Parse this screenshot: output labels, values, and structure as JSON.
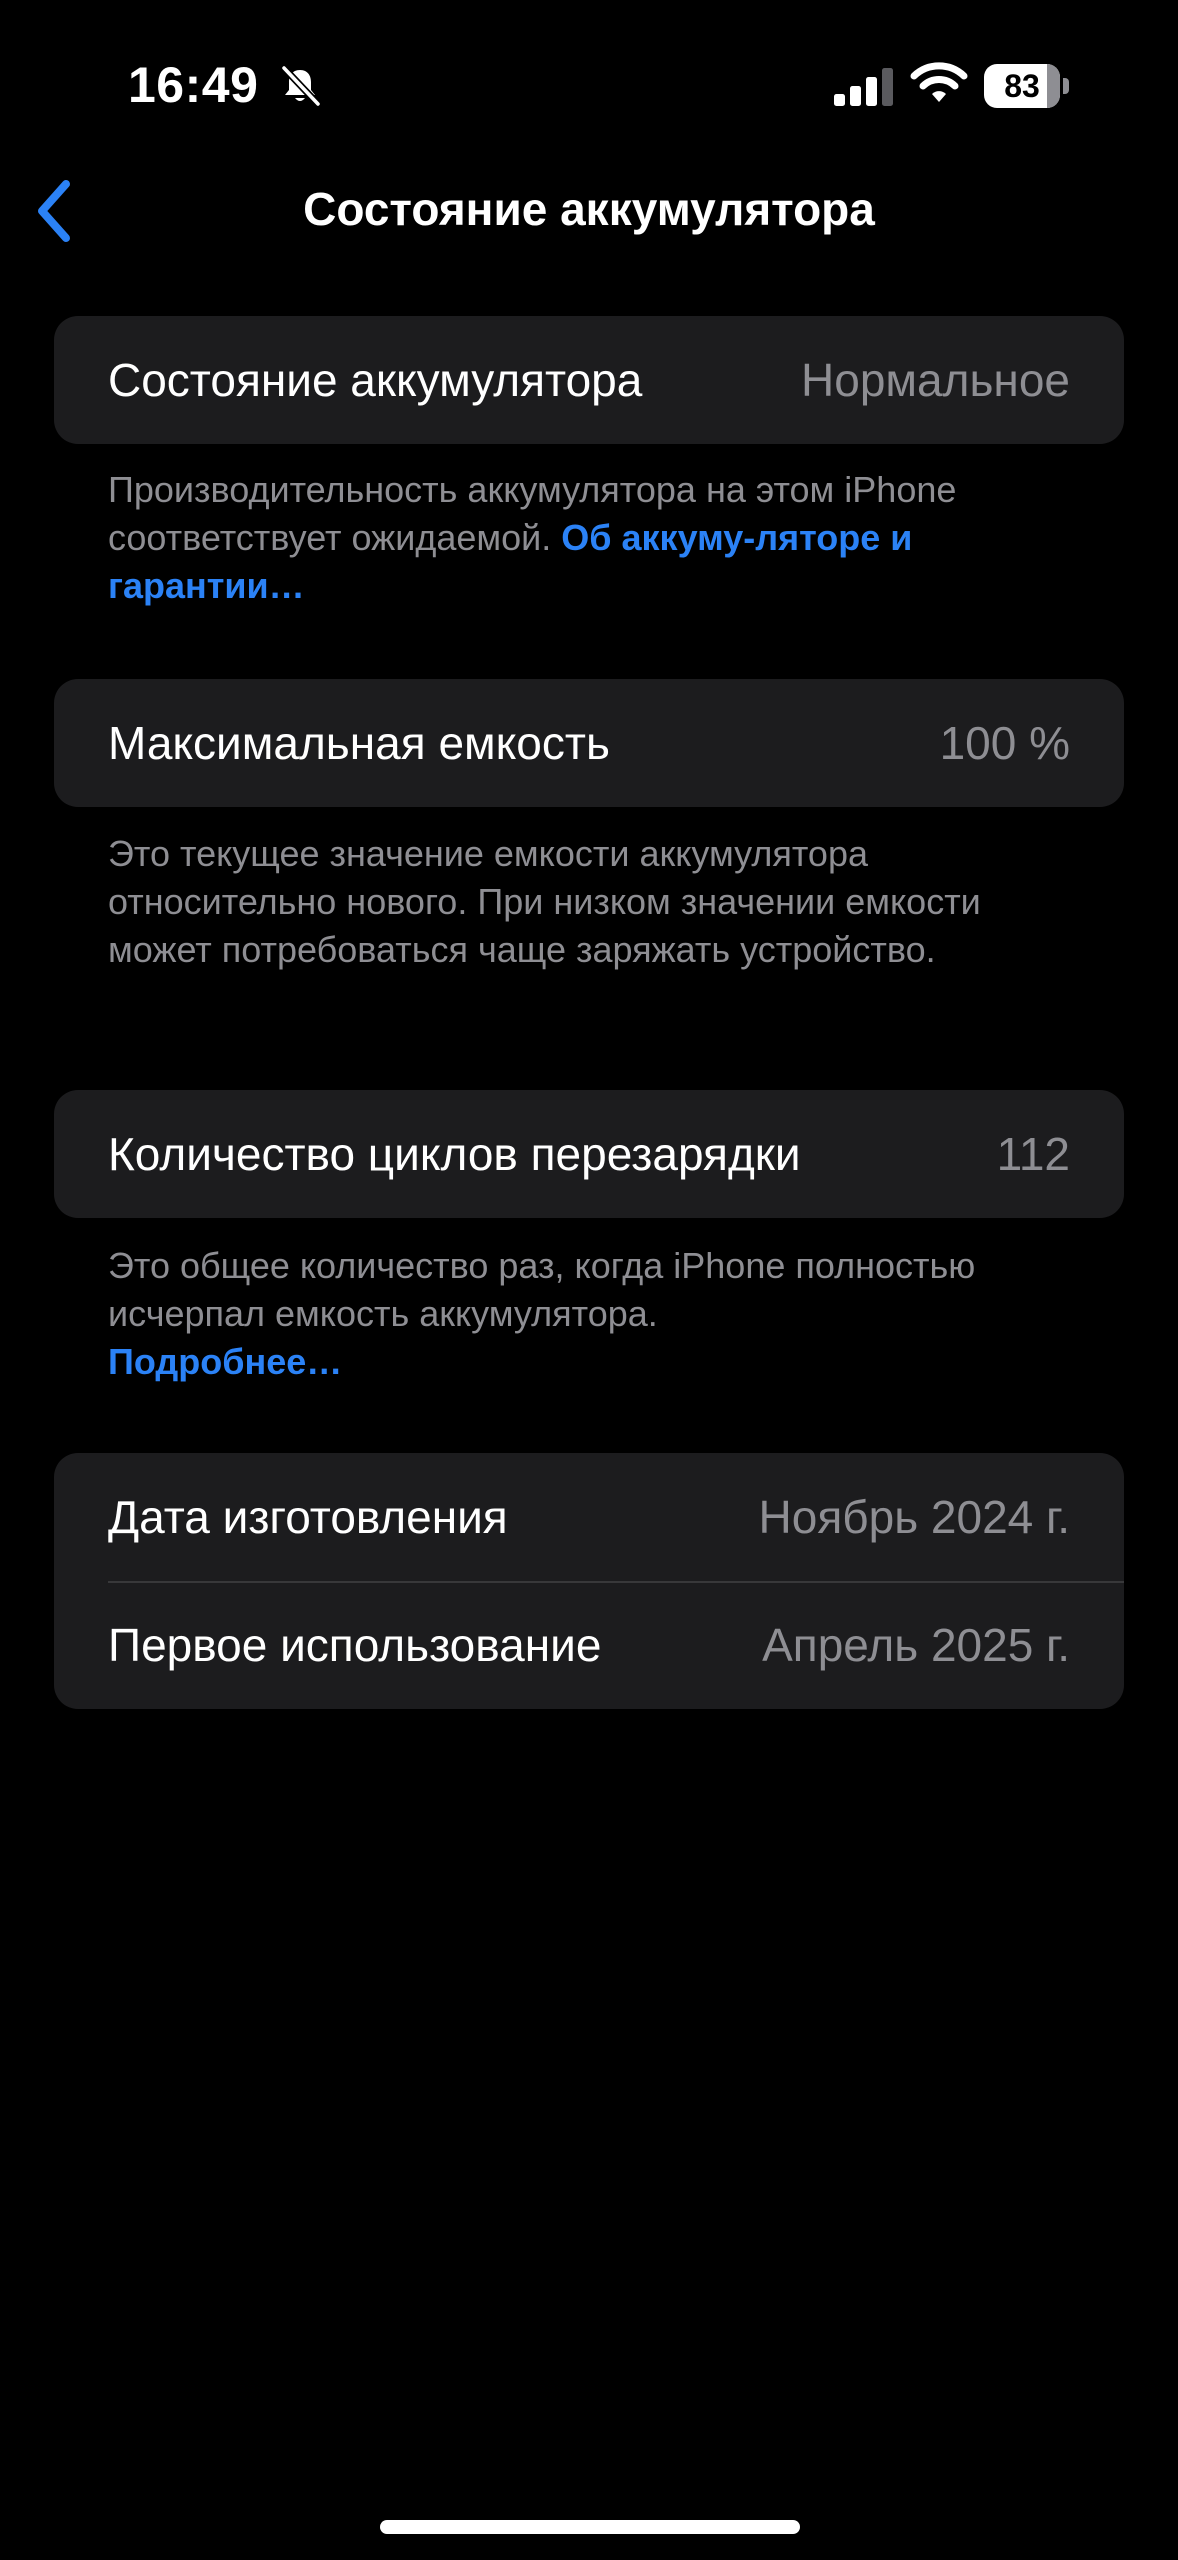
{
  "status_bar": {
    "time": "16:49",
    "battery_level": "83",
    "battery_fraction": 0.83
  },
  "nav": {
    "title": "Состояние аккумулятора"
  },
  "health": {
    "label": "Состояние аккумулятора",
    "value": "Нормальное",
    "footnote_text": "Производительность аккумулятора на этом iPhone соответствует ожидаемой. ",
    "footnote_link": "Об аккуму-ляторе и гарантии…"
  },
  "capacity": {
    "label": "Максимальная емкость",
    "value": "100 %",
    "footnote": "Это текущее значение емкости аккумулятора относительно нового. При низком значении емкости может потребоваться чаще заряжать устройство."
  },
  "cycles": {
    "label": "Количество циклов перезарядки",
    "value": "112",
    "footnote_text": "Это общее количество раз, когда iPhone полностью исчерпал емкость аккумулятора.",
    "footnote_link": "Подробнее…"
  },
  "dates": {
    "manufacture_label": "Дата изготовления",
    "manufacture_value": "Ноябрь 2024 г.",
    "first_use_label": "Первое использование",
    "first_use_value": "Апрель 2025 г."
  },
  "colors": {
    "background": "#000000",
    "cell": "#1c1c1e",
    "secondary_text": "#8e8e93",
    "accent": "#2b82f6"
  }
}
